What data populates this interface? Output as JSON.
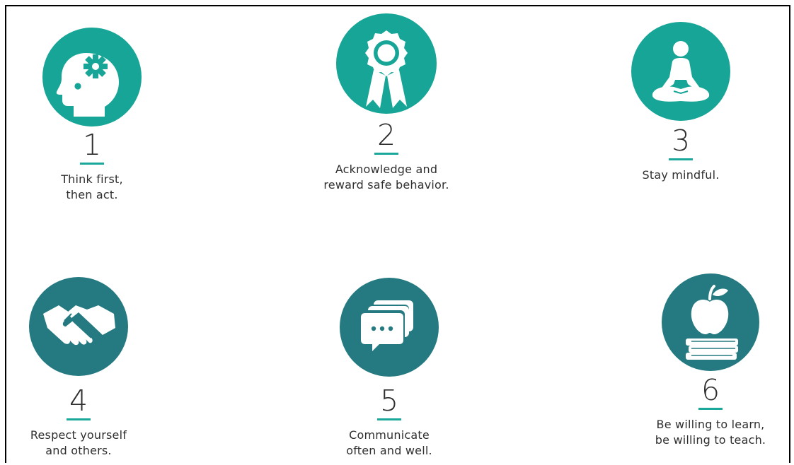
{
  "colors": {
    "teal_light": "#16a596",
    "teal_dark": "#247a80",
    "text": "#2f2f2f",
    "underline": "#1aa89a"
  },
  "items": [
    {
      "number": "1",
      "lines": [
        "Think first,",
        "then act."
      ],
      "icon": "head-gear-icon"
    },
    {
      "number": "2",
      "lines": [
        "Acknowledge and",
        "reward safe behavior."
      ],
      "icon": "award-ribbon-icon"
    },
    {
      "number": "3",
      "lines": [
        "Stay mindful.",
        ""
      ],
      "icon": "meditation-icon"
    },
    {
      "number": "4",
      "lines": [
        "Respect yourself",
        "and others."
      ],
      "icon": "handshake-icon"
    },
    {
      "number": "5",
      "lines": [
        "Communicate",
        "often and well."
      ],
      "icon": "chat-bubbles-icon"
    },
    {
      "number": "6",
      "lines": [
        "Be willing to learn,",
        "be willing to teach."
      ],
      "icon": "apple-books-icon"
    }
  ]
}
